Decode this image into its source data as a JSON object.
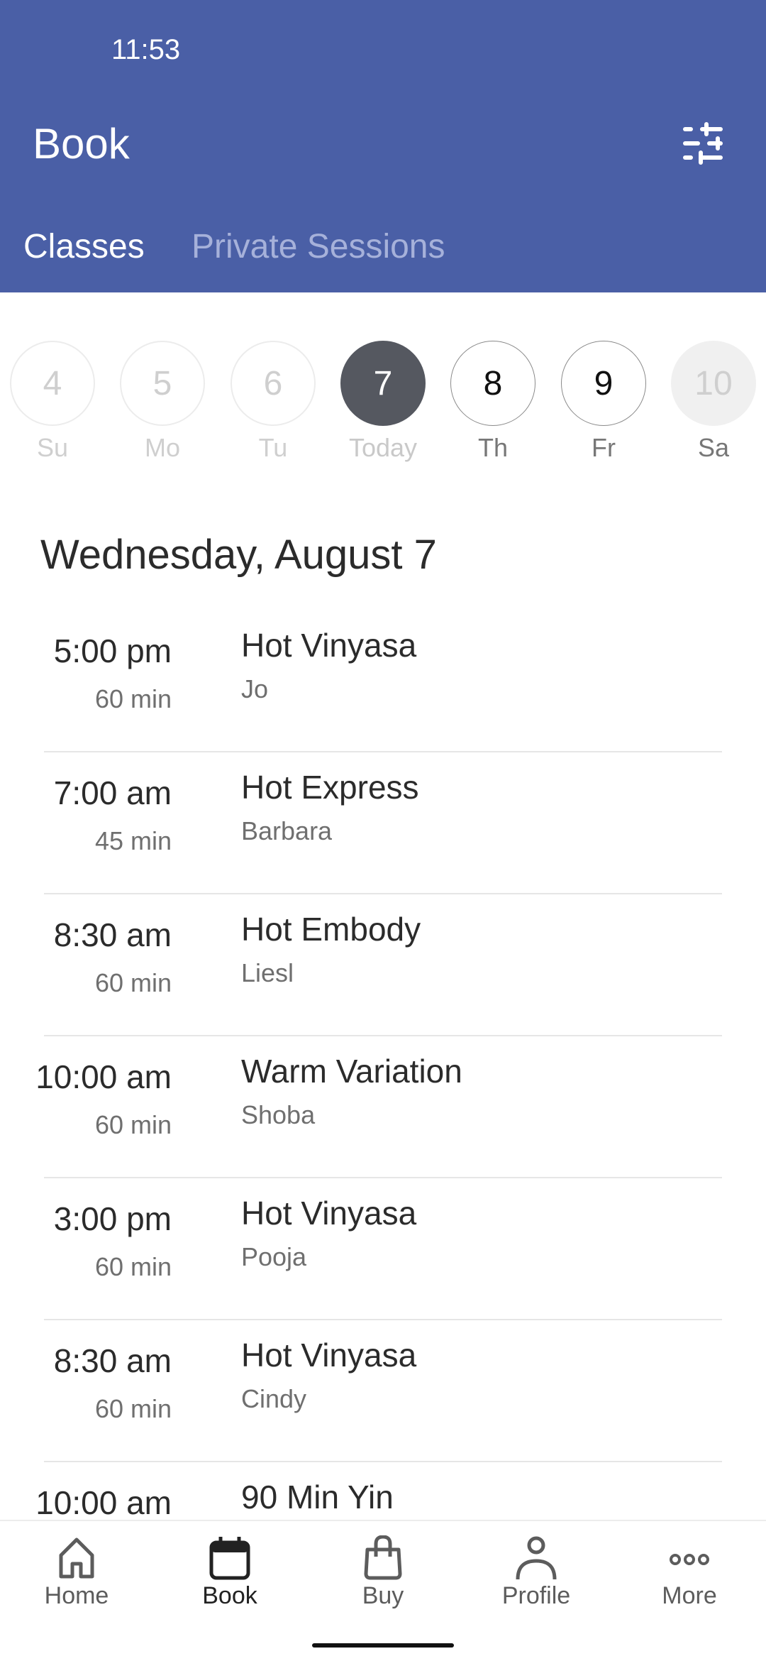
{
  "status_bar": {
    "time": "11:53"
  },
  "header": {
    "title": "Book",
    "filter_icon": "sliders-icon",
    "tabs": [
      {
        "label": "Classes",
        "active": true
      },
      {
        "label": "Private Sessions",
        "active": false
      }
    ]
  },
  "date_strip": {
    "days": [
      {
        "number": "4",
        "label": "Su",
        "state": "past"
      },
      {
        "number": "5",
        "label": "Mo",
        "state": "past"
      },
      {
        "number": "6",
        "label": "Tu",
        "state": "past"
      },
      {
        "number": "7",
        "label": "Today",
        "state": "selected"
      },
      {
        "number": "8",
        "label": "Th",
        "state": "future"
      },
      {
        "number": "9",
        "label": "Fr",
        "state": "future"
      },
      {
        "number": "10",
        "label": "Sa",
        "state": "unavailable"
      }
    ]
  },
  "schedule": {
    "heading": "Wednesday, August 7",
    "classes": [
      {
        "time": "5:00 pm",
        "duration": "60 min",
        "name": "Hot Vinyasa",
        "teacher": "Jo"
      },
      {
        "time": "7:00 am",
        "duration": "45 min",
        "name": "Hot Express",
        "teacher": "Barbara"
      },
      {
        "time": "8:30 am",
        "duration": "60 min",
        "name": "Hot Embody",
        "teacher": "Liesl"
      },
      {
        "time": "10:00 am",
        "duration": "60 min",
        "name": "Warm Variation",
        "teacher": "Shoba"
      },
      {
        "time": "3:00 pm",
        "duration": "60 min",
        "name": "Hot Vinyasa",
        "teacher": "Pooja"
      },
      {
        "time": "8:30 am",
        "duration": "60 min",
        "name": "Hot Vinyasa",
        "teacher": "Cindy"
      },
      {
        "time": "10:00 am",
        "duration": "",
        "name": "90 Min Yin",
        "teacher": ""
      }
    ]
  },
  "bottom_nav": {
    "items": [
      {
        "label": "Home",
        "icon": "home-icon",
        "active": false
      },
      {
        "label": "Book",
        "icon": "calendar-icon",
        "active": true
      },
      {
        "label": "Buy",
        "icon": "shopping-bag-icon",
        "active": false
      },
      {
        "label": "Profile",
        "icon": "person-icon",
        "active": false
      },
      {
        "label": "More",
        "icon": "more-dots-icon",
        "active": false
      }
    ]
  },
  "colors": {
    "header_bg": "#4a5fa6",
    "selected_day": "#555860",
    "tab_inactive": "#a6b1da"
  }
}
